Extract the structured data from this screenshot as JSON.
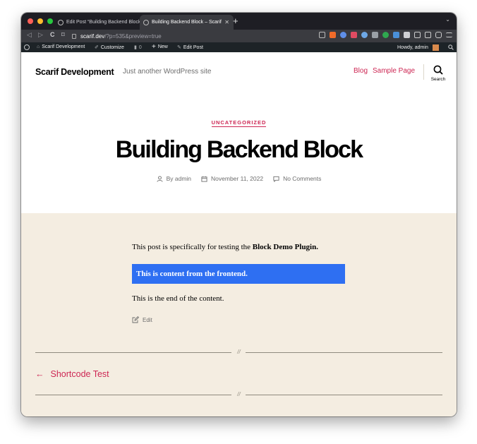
{
  "browser": {
    "tabs": [
      {
        "title": "Edit Post “Building Backend Block”",
        "active": false
      },
      {
        "title": "Building Backend Block – Scarif",
        "active": true
      }
    ],
    "new_tab": "+",
    "tab_menu": "⌄",
    "nav": {
      "back": "◁",
      "forward": "▷",
      "reload": "C",
      "bookmark": "⌑"
    },
    "url": {
      "domain": "scarif.dev",
      "path": "/?p=535&preview=true"
    },
    "colors": {
      "light_red": "#ff5f57",
      "light_yellow": "#febc2e",
      "light_green": "#28c840"
    }
  },
  "adminbar": {
    "site": "Scarif Development",
    "customize": "Customize",
    "comments_count": "0",
    "new": "New",
    "edit_post": "Edit Post",
    "howdy": "Howdy, admin"
  },
  "header": {
    "site_title": "Scarif Development",
    "site_description": "Just another WordPress site",
    "menu": [
      "Blog",
      "Sample Page"
    ],
    "search_label": "Search"
  },
  "post": {
    "category": "UNCATEGORIZED",
    "title": "Building Backend Block",
    "author": "By admin",
    "date": "November 11, 2022",
    "comments": "No Comments",
    "intro_text": "This post is specifically for testing the ",
    "intro_bold": "Block Demo Plugin.",
    "block_text": "This is content from the frontend.",
    "end_text": "This is the end of the content.",
    "edit_label": "Edit"
  },
  "navigation": {
    "separator": "//",
    "previous_arrow": "←",
    "previous_title": "Shortcode Test"
  },
  "theme_colors": {
    "accent": "#cd2653",
    "background": "#f4ede1",
    "block_blue": "#2e6ff2"
  }
}
